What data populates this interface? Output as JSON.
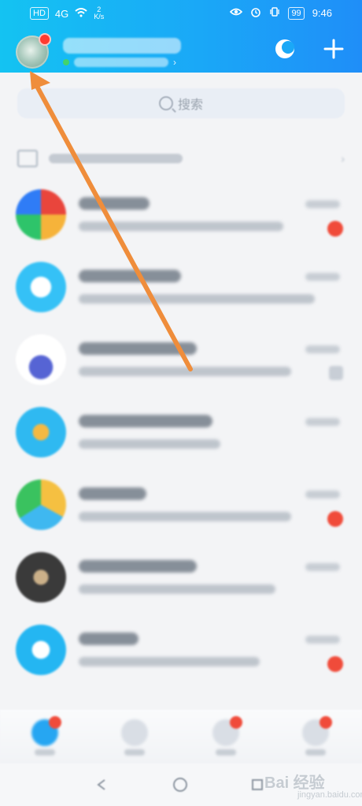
{
  "status_bar": {
    "left_items": [
      "HD",
      "4G",
      "2",
      "K/s"
    ],
    "right_items": [
      "99",
      "9:46"
    ]
  },
  "header": {
    "moon_icon": "moon-icon",
    "plus_icon": "plus-icon"
  },
  "search": {
    "placeholder": "搜索"
  },
  "colors": {
    "header_start": "#14c3f2",
    "header_end": "#1f8ef8",
    "badge_red": "#f04b3a",
    "arrow": "#ef8d3b"
  },
  "watermark": {
    "main": "Bai 经验",
    "sub": "jingyan.baidu.com"
  }
}
